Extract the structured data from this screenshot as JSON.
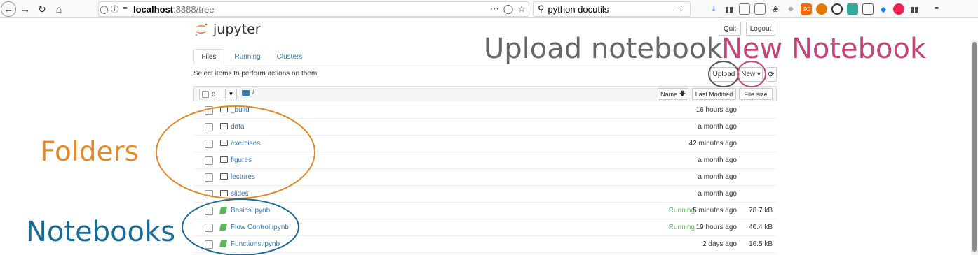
{
  "browser": {
    "url_host": "localhost",
    "url_port_path": ":8888/tree",
    "search_text": "python docutils"
  },
  "jupyter": {
    "logo_text": "jupyter",
    "quit_label": "Quit",
    "logout_label": "Logout",
    "tabs": [
      {
        "label": "Files"
      },
      {
        "label": "Running"
      },
      {
        "label": "Clusters"
      }
    ],
    "select_info": "Select items to perform actions on them.",
    "upload_label": "Upload",
    "new_label": "New ▾",
    "selected_count": "0",
    "breadcrumb": "/",
    "columns": {
      "name": "Name",
      "last_modified": "Last Modified",
      "file_size": "File size"
    },
    "rows": [
      {
        "name": "_build",
        "type": "folder",
        "running": "",
        "modified": "16 hours ago",
        "size": ""
      },
      {
        "name": "data",
        "type": "folder",
        "running": "",
        "modified": "a month ago",
        "size": ""
      },
      {
        "name": "exercises",
        "type": "folder",
        "running": "",
        "modified": "42 minutes ago",
        "size": ""
      },
      {
        "name": "figures",
        "type": "folder",
        "running": "",
        "modified": "a month ago",
        "size": ""
      },
      {
        "name": "lectures",
        "type": "folder",
        "running": "",
        "modified": "a month ago",
        "size": ""
      },
      {
        "name": "slides",
        "type": "folder",
        "running": "",
        "modified": "a month ago",
        "size": ""
      },
      {
        "name": "Basics.ipynb",
        "type": "notebook",
        "running": "Running",
        "modified": "5 minutes ago",
        "size": "78.7 kB"
      },
      {
        "name": "Flow Control.ipynb",
        "type": "notebook",
        "running": "Running",
        "modified": "19 hours ago",
        "size": "40.4 kB"
      },
      {
        "name": "Functions.ipynb",
        "type": "notebook",
        "running": "",
        "modified": "2 days ago",
        "size": "16.5 kB"
      }
    ]
  },
  "annotations": {
    "upload": "Upload notebook",
    "new": "New Notebook",
    "folders": "Folders",
    "notebooks": "Notebooks"
  },
  "colors": {
    "annotation_upload": "#666666",
    "annotation_new": "#c3467a",
    "annotation_folders": "#e08a2a",
    "annotation_notebooks": "#1a6b95",
    "link": "#337ab7",
    "running": "#5cb85c",
    "jupyter_orange": "#f37726"
  }
}
